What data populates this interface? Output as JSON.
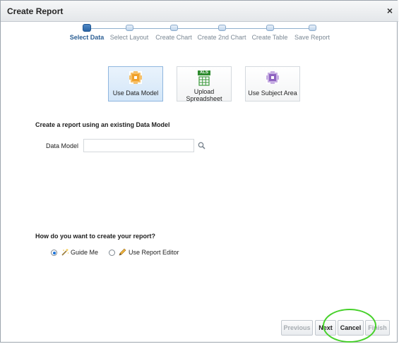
{
  "dialog": {
    "title": "Create Report",
    "close_glyph": "×"
  },
  "steps": [
    {
      "label": "Select Data",
      "active": true
    },
    {
      "label": "Select Layout",
      "active": false
    },
    {
      "label": "Create Chart",
      "active": false
    },
    {
      "label": "Create 2nd Chart",
      "active": false
    },
    {
      "label": "Create Table",
      "active": false
    },
    {
      "label": "Save Report",
      "active": false
    }
  ],
  "sources": [
    {
      "label": "Use Data Model",
      "icon": "data-model-icon",
      "selected": true
    },
    {
      "label_line1": "Upload",
      "label_line2": "Spreadsheet",
      "badge": "XLS",
      "icon": "spreadsheet-icon",
      "selected": false
    },
    {
      "label": "Use Subject Area",
      "icon": "subject-area-icon",
      "selected": false
    }
  ],
  "data_model_section": {
    "heading": "Create a report using an existing Data Model",
    "field_label": "Data Model",
    "field_value": ""
  },
  "creation_mode": {
    "heading": "How do you want to create your report?",
    "options": [
      {
        "label": "Guide Me",
        "selected": true,
        "icon": "magic-wand-icon"
      },
      {
        "label": "Use Report Editor",
        "selected": false,
        "icon": "pencil-icon"
      }
    ]
  },
  "buttons": {
    "previous": "Previous",
    "next": "Next",
    "cancel": "Cancel",
    "finish": "Finish"
  },
  "colors": {
    "accent": "#2c5f94",
    "highlight_ring": "#46d12a",
    "data_model_icon": "#f0a02a",
    "spreadsheet_icon": "#3c9a3c",
    "subject_area_icon": "#8e62c0"
  }
}
